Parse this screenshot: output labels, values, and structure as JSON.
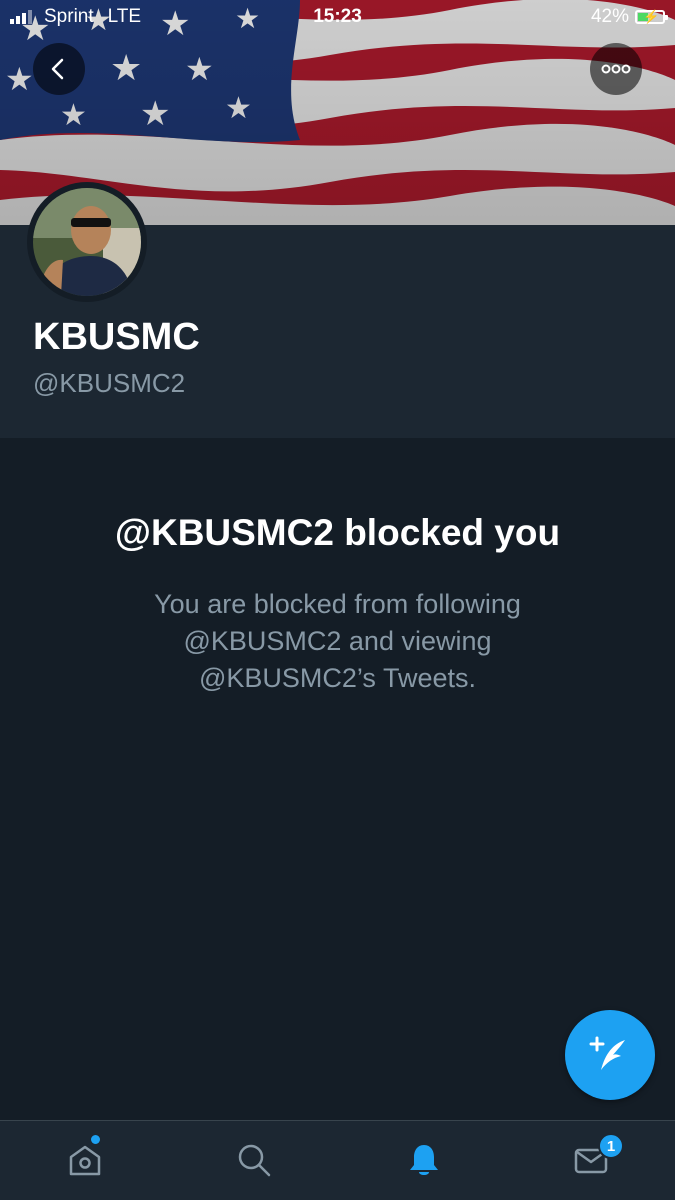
{
  "status_bar": {
    "carrier": "Sprint",
    "network": "LTE",
    "time": "15:23",
    "battery": "42%",
    "battery_level": 0.42
  },
  "profile": {
    "display_name": "KBUSMC",
    "handle": "@KBUSMC2"
  },
  "blocked": {
    "title": "@KBUSMC2 blocked you",
    "message": "You are blocked from following @KBUSMC2 and viewing @KBUSMC2’s Tweets."
  },
  "tab_bar": {
    "items": [
      {
        "icon": "home-icon",
        "has_dot": true
      },
      {
        "icon": "search-icon"
      },
      {
        "icon": "bell-icon",
        "active": true
      },
      {
        "icon": "mail-icon",
        "badge": "1"
      }
    ]
  },
  "colors": {
    "background": "#141d26",
    "panel": "#1c2732",
    "accent": "#1da1f2",
    "secondary_text": "#8899a6"
  }
}
